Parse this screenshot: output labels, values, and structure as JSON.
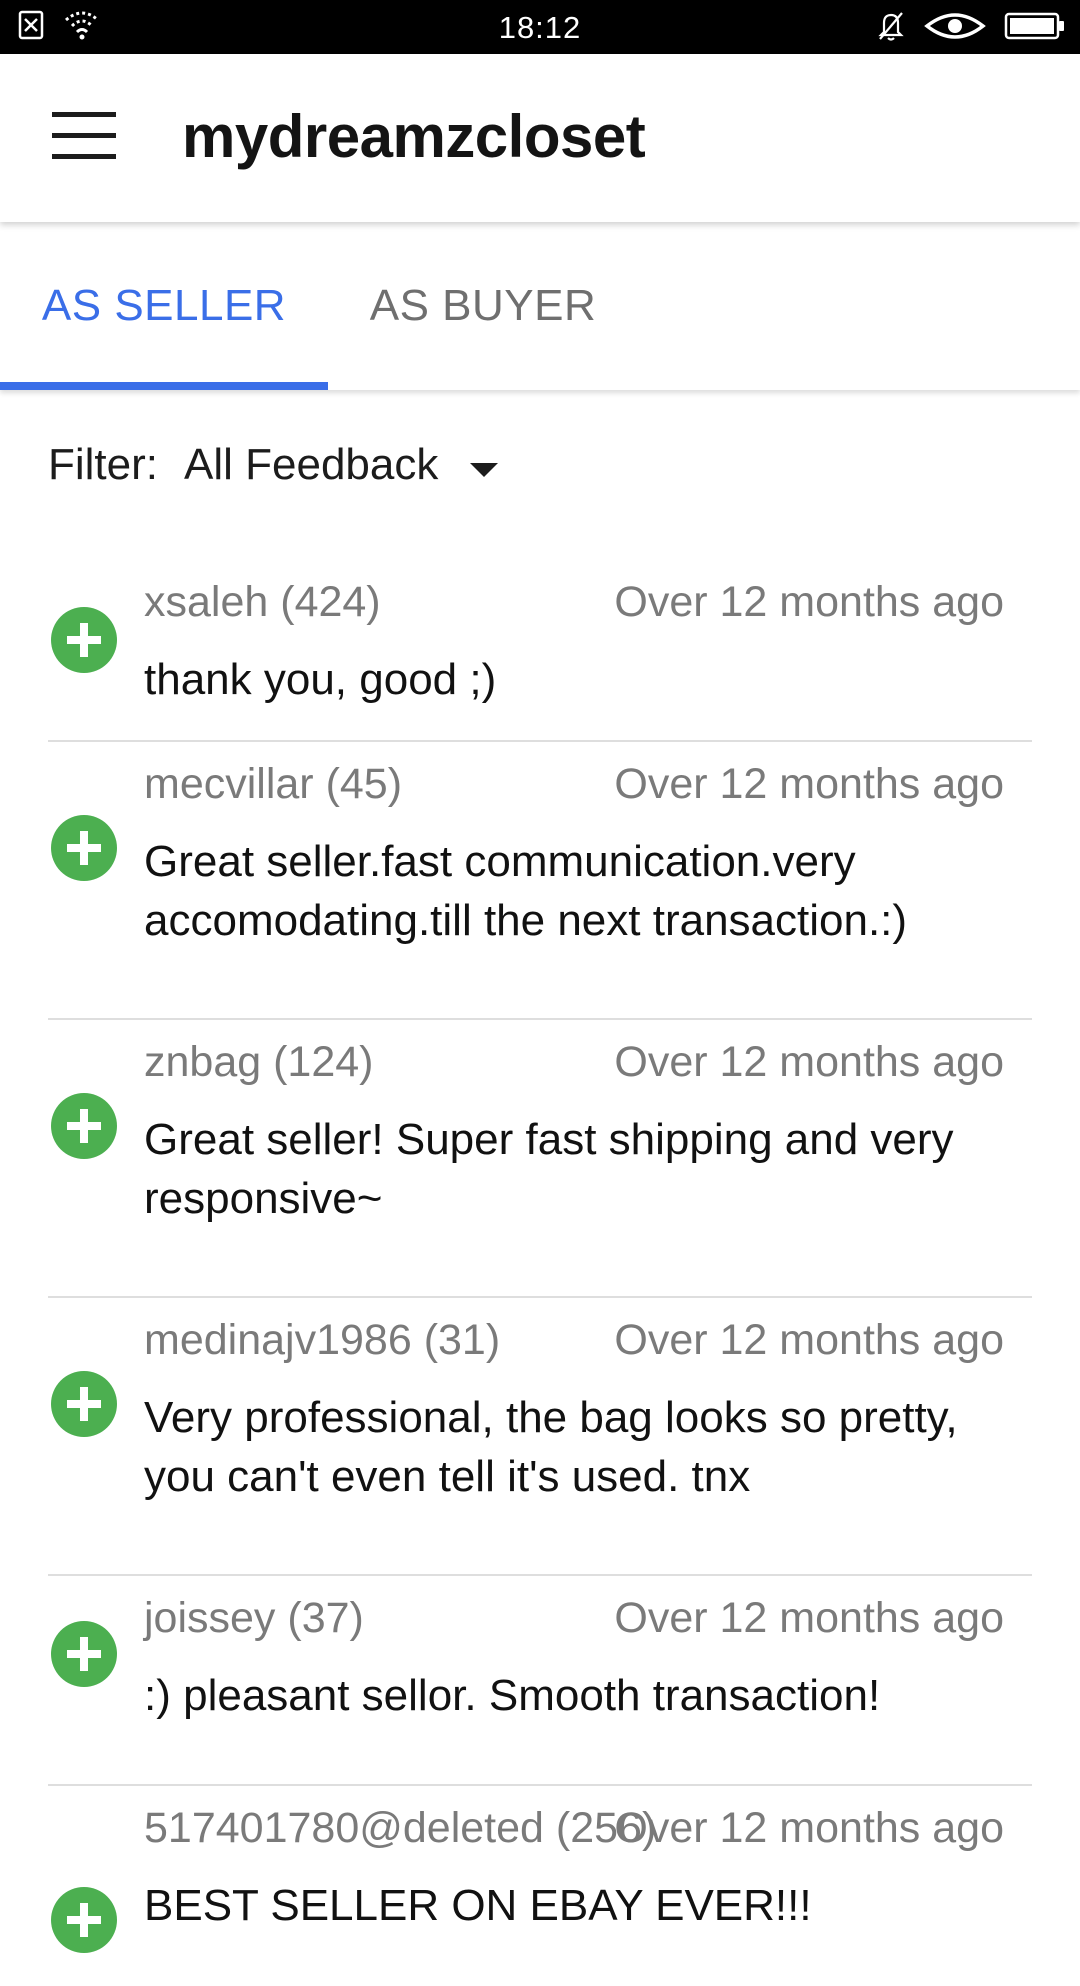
{
  "status_bar": {
    "time": "18:12",
    "left_icons": [
      "sim-disabled-icon",
      "wifi-icon"
    ],
    "right_icons": [
      "bell-off-icon",
      "eye-icon",
      "battery-icon"
    ]
  },
  "app_bar": {
    "title": "mydreamzcloset",
    "menu_icon": "hamburger-menu-icon"
  },
  "tabs": [
    {
      "label": "AS SELLER",
      "active": true
    },
    {
      "label": "AS BUYER",
      "active": false
    }
  ],
  "filter": {
    "label": "Filter:",
    "value": "All Feedback"
  },
  "colors": {
    "accent": "#3a6ee8",
    "positive": "#4caf50",
    "meta_text": "#7a7a7a"
  },
  "feedback": [
    {
      "user": "xsaleh (424)",
      "time": "Over 12 months ago",
      "text": "thank you, good ;)",
      "rating": "positive"
    },
    {
      "user": "mecvillar (45)",
      "time": "Over 12 months ago",
      "text": "Great seller.fast communication.very accomodating.till the next transaction.:)",
      "rating": "positive"
    },
    {
      "user": "znbag (124)",
      "time": "Over 12 months ago",
      "text": "Great seller!  Super fast shipping and very responsive~",
      "rating": "positive"
    },
    {
      "user": "medinajv1986 (31)",
      "time": "Over 12 months ago",
      "text": "Very professional, the bag looks so pretty, you can't even tell it's used. tnx",
      "rating": "positive"
    },
    {
      "user": "joissey (37)",
      "time": "Over 12 months ago",
      "text": ":) pleasant sellor. Smooth transaction!",
      "rating": "positive"
    },
    {
      "user": "517401780@deleted (256)",
      "time": "Over 12 months ago",
      "text": "BEST SELLER ON EBAY EVER!!!",
      "rating": "positive"
    }
  ]
}
